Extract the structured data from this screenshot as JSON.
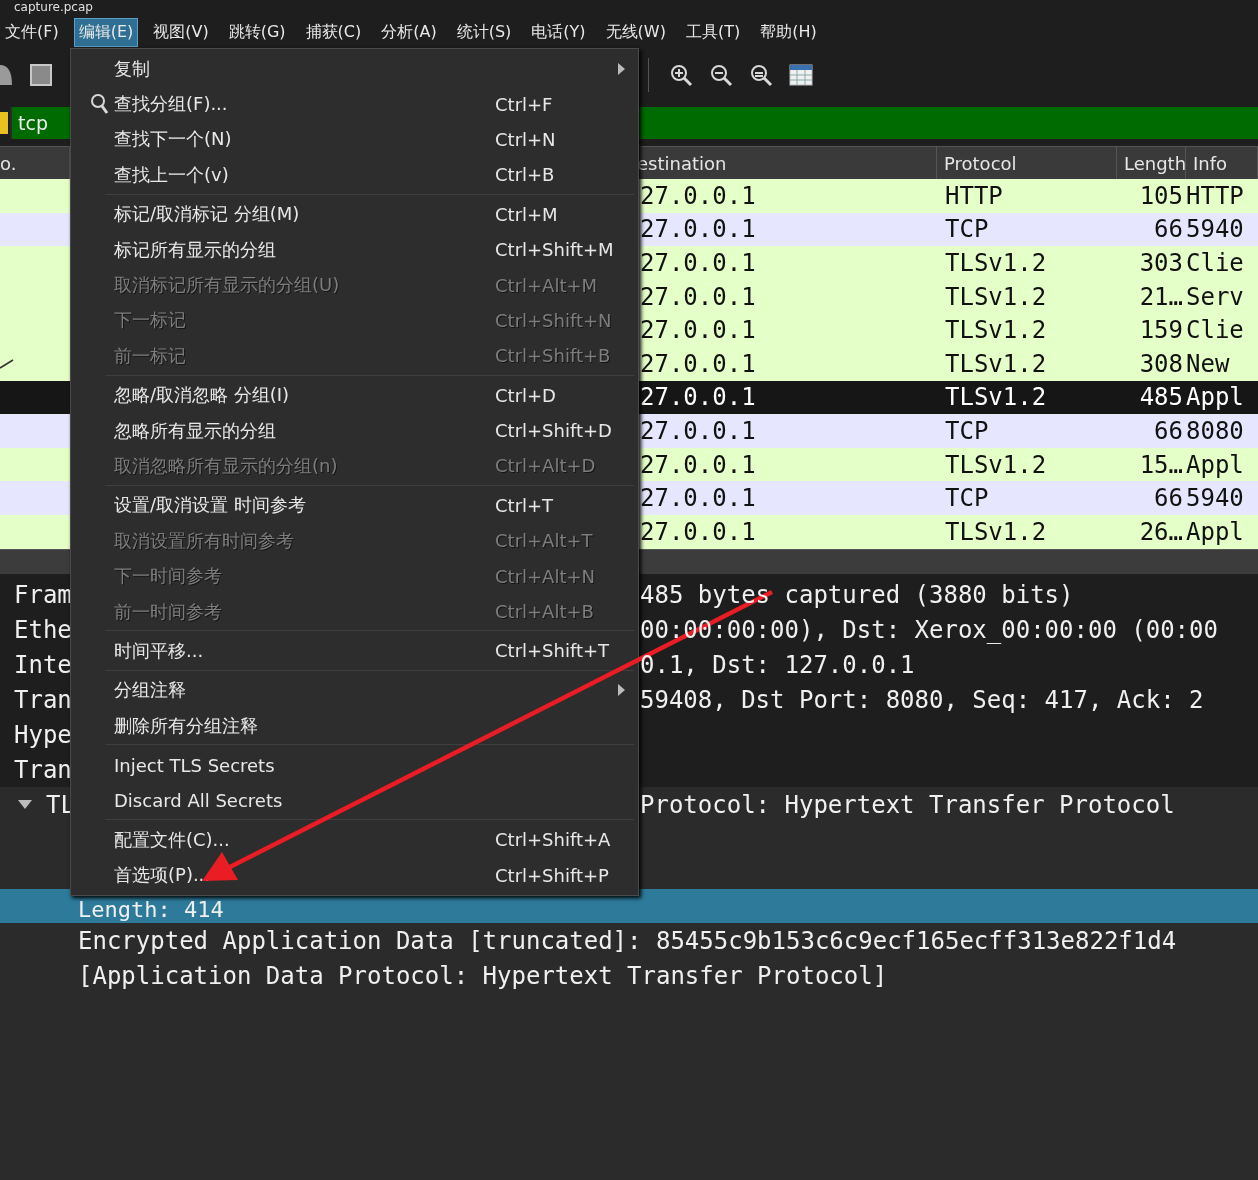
{
  "window": {
    "title": "capture.pcap"
  },
  "menubar": [
    {
      "label": "文件(F)",
      "selected": false
    },
    {
      "label": "编辑(E)",
      "selected": true
    },
    {
      "label": "视图(V)",
      "selected": false
    },
    {
      "label": "跳转(G)",
      "selected": false
    },
    {
      "label": "捕获(C)",
      "selected": false
    },
    {
      "label": "分析(A)",
      "selected": false
    },
    {
      "label": "统计(S)",
      "selected": false
    },
    {
      "label": "电话(Y)",
      "selected": false
    },
    {
      "label": "无线(W)",
      "selected": false
    },
    {
      "label": "工具(T)",
      "selected": false
    },
    {
      "label": "帮助(H)",
      "selected": false
    }
  ],
  "filter": {
    "value": "tcp"
  },
  "packet_list": {
    "columns": [
      "o.",
      "estination",
      "Protocol",
      "Length",
      "Info"
    ],
    "rows": [
      {
        "destination": "27.0.0.1",
        "protocol": "HTTP",
        "length": "105",
        "info": "HTTP",
        "selected": false,
        "related": false,
        "color": "#e4ffc7"
      },
      {
        "destination": "27.0.0.1",
        "protocol": "TCP",
        "length": "66",
        "info": "5940",
        "selected": false,
        "related": false,
        "color": "#e7e6ff"
      },
      {
        "destination": "27.0.0.1",
        "protocol": "TLSv1.2",
        "length": "303",
        "info": "Clie",
        "selected": false,
        "related": false,
        "color": "#e4ffc7"
      },
      {
        "destination": "27.0.0.1",
        "protocol": "TLSv1.2",
        "length": "21…",
        "info": "Serv",
        "selected": false,
        "related": false,
        "color": "#e4ffc7"
      },
      {
        "destination": "27.0.0.1",
        "protocol": "TLSv1.2",
        "length": "159",
        "info": "Clie",
        "selected": false,
        "related": false,
        "color": "#e4ffc7"
      },
      {
        "destination": "27.0.0.1",
        "protocol": "TLSv1.2",
        "length": "308",
        "info": "New",
        "selected": false,
        "related": true,
        "color": "#e4ffc7"
      },
      {
        "destination": "27.0.0.1",
        "protocol": "TLSv1.2",
        "length": "485",
        "info": "Appl",
        "selected": true,
        "related": false
      },
      {
        "destination": "27.0.0.1",
        "protocol": "TCP",
        "length": "66",
        "info": "8080",
        "selected": false,
        "related": false,
        "color": "#e7e6ff"
      },
      {
        "destination": "27.0.0.1",
        "protocol": "TLSv1.2",
        "length": "15…",
        "info": "Appl",
        "selected": false,
        "related": false,
        "color": "#e4ffc7"
      },
      {
        "destination": "27.0.0.1",
        "protocol": "TCP",
        "length": "66",
        "info": "5940",
        "selected": false,
        "related": false,
        "color": "#e7e6ff"
      },
      {
        "destination": "27.0.0.1",
        "protocol": "TLSv1.2",
        "length": "26…",
        "info": "Appl",
        "selected": false,
        "related": false,
        "color": "#e4ffc7"
      }
    ]
  },
  "details": {
    "lines": [
      {
        "left": "Fram",
        "right": "485 bytes captured (3880 bits)"
      },
      {
        "left": "Ethe",
        "right": "00:00:00:00), Dst: Xerox_00:00:00 (00:00"
      },
      {
        "left": "Inte",
        "right": "0.1, Dst: 127.0.0.1"
      },
      {
        "left": "Tran",
        "right": "59408, Dst Port: 8080, Seq: 417, Ack: 2"
      },
      {
        "left": "Hype"
      },
      {
        "left": "Tran"
      }
    ],
    "expanded_item": {
      "left": "TL",
      "right": "Protocol: Hypertext Transfer Protocol",
      "expanded": true,
      "children": [
        {
          "text": "Length: 414",
          "selected": true
        },
        {
          "text": "Encrypted Application Data [truncated]: 85455c9b153c6c9ecf165ecff313e822f1d4",
          "selected": false
        },
        {
          "text": "[Application Data Protocol: Hypertext Transfer Protocol]",
          "selected": false
        }
      ]
    }
  },
  "edit_menu": {
    "sections": [
      [
        {
          "label": "复制",
          "disabled": false,
          "submenu": true
        },
        {
          "label": "查找分组(F)...",
          "shortcut": "Ctrl+F",
          "disabled": false,
          "kind": "search"
        },
        {
          "label": "查找下一个(N)",
          "shortcut": "Ctrl+N",
          "disabled": false
        },
        {
          "label": "查找上一个(v)",
          "shortcut": "Ctrl+B",
          "disabled": false
        }
      ],
      [
        {
          "label": "标记/取消标记 分组(M)",
          "shortcut": "Ctrl+M",
          "disabled": false
        },
        {
          "label": "标记所有显示的分组",
          "shortcut": "Ctrl+Shift+M",
          "disabled": false
        },
        {
          "label": "取消标记所有显示的分组(U)",
          "shortcut": "Ctrl+Alt+M",
          "disabled": true
        },
        {
          "label": "下一标记",
          "shortcut": "Ctrl+Shift+N",
          "disabled": true
        },
        {
          "label": "前一标记",
          "shortcut": "Ctrl+Shift+B",
          "disabled": true
        }
      ],
      [
        {
          "label": "忽略/取消忽略 分组(I)",
          "shortcut": "Ctrl+D",
          "disabled": false
        },
        {
          "label": "忽略所有显示的分组",
          "shortcut": "Ctrl+Shift+D",
          "disabled": false
        },
        {
          "label": "取消忽略所有显示的分组(n)",
          "shortcut": "Ctrl+Alt+D",
          "disabled": true
        }
      ],
      [
        {
          "label": "设置/取消设置 时间参考",
          "shortcut": "Ctrl+T",
          "disabled": false
        },
        {
          "label": "取消设置所有时间参考",
          "shortcut": "Ctrl+Alt+T",
          "disabled": true
        },
        {
          "label": "下一时间参考",
          "shortcut": "Ctrl+Alt+N",
          "disabled": true
        },
        {
          "label": "前一时间参考",
          "shortcut": "Ctrl+Alt+B",
          "disabled": true
        }
      ],
      [
        {
          "label": "时间平移...",
          "shortcut": "Ctrl+Shift+T",
          "disabled": false
        }
      ],
      [
        {
          "label": "分组注释",
          "disabled": false,
          "submenu": true
        },
        {
          "label": "删除所有分组注释",
          "disabled": false
        }
      ],
      [
        {
          "label": "Inject TLS Secrets",
          "disabled": false
        },
        {
          "label": "Discard All Secrets",
          "disabled": false
        }
      ],
      [
        {
          "label": "配置文件(C)...",
          "shortcut": "Ctrl+Shift+A",
          "disabled": false
        },
        {
          "label": "首选项(P)...",
          "shortcut": "Ctrl+Shift+P",
          "disabled": false
        }
      ]
    ]
  }
}
